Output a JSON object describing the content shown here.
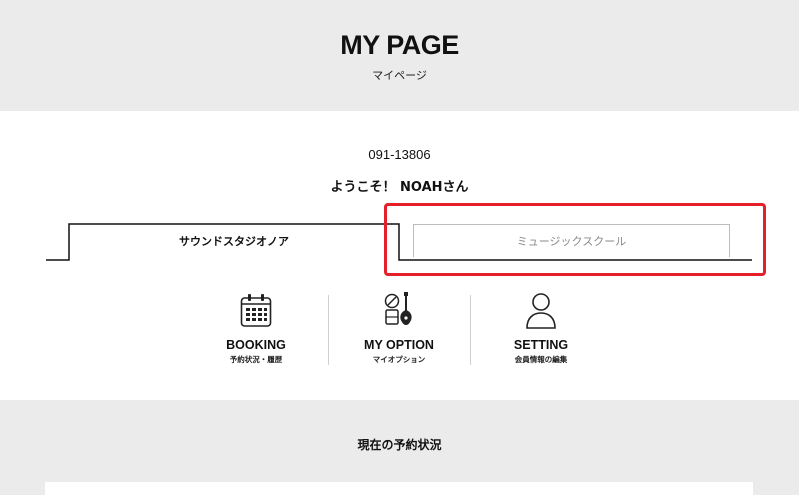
{
  "header": {
    "title": "MY PAGE",
    "subtitle": "マイページ"
  },
  "member": {
    "id": "091-13806",
    "welcome": "ようこそ！ NOAHさん"
  },
  "tabs": [
    {
      "label": "サウンドスタジオノア",
      "active": true
    },
    {
      "label": "ミュージックスクール",
      "active": false
    }
  ],
  "menu": [
    {
      "label": "BOOKING",
      "sub": "予約状況・履歴",
      "icon": "calendar-icon"
    },
    {
      "label": "MY OPTION",
      "sub": "マイオプション",
      "icon": "guitar-equipment-icon"
    },
    {
      "label": "SETTING",
      "sub": "会員情報の編集",
      "icon": "user-icon"
    }
  ],
  "reservation": {
    "title": "現在の予約状況"
  },
  "colors": {
    "header_bg": "#ebebeb",
    "highlight": "#e4202a",
    "inactive_tab_text": "#8a8a8a"
  }
}
